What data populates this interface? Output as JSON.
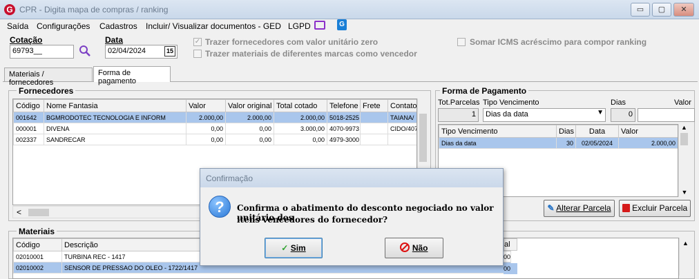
{
  "window": {
    "title": "CPR - Digita mapa de compras / ranking",
    "min": "▭",
    "max": "▢",
    "close": "✕"
  },
  "menu": {
    "items": [
      "Saída",
      "Configurações",
      "Cadastros",
      "Incluir/ Visualizar documentos - GED",
      "LGPD"
    ]
  },
  "header": {
    "cotacao_label": "Cotação",
    "cotacao_value": "69793__",
    "data_label": "Data",
    "data_value": "02/04/2024",
    "calendar": "15",
    "opt1": "Trazer fornecedores com valor unitário zero",
    "opt1_checked": "✓",
    "opt2": "Trazer materiais de diferentes marcas como vencedor",
    "opt3": "Somar ICMS acréscimo para compor ranking"
  },
  "tabs": [
    "Materiais / fornecedores",
    "Forma de pagamento"
  ],
  "fornecedores": {
    "title": "Fornecedores",
    "columns": [
      "Código",
      "Nome Fantasia",
      "Valor",
      "Valor original",
      "Total cotado",
      "Telefone",
      "Frete",
      "Contato"
    ],
    "rows": [
      [
        "001642",
        "BGMRODOTEC TECNOLOGIA E INFORM",
        "2.000,00",
        "2.000,00",
        "2.000,00",
        "5018-2525",
        "",
        "TAIANA/"
      ],
      [
        "000001",
        "DIVENA",
        "0,00",
        "0,00",
        "3.000,00",
        "4070-9973",
        "",
        "CIDO/407"
      ],
      [
        "002337",
        "SANDRECAR",
        "0,00",
        "0,00",
        "0,00",
        "4979-3000",
        "",
        ""
      ]
    ],
    "scroll_left": "<"
  },
  "pagamento": {
    "title": "Forma de Pagamento",
    "tot_parcelas_label": "Tot.Parcelas",
    "tot_parcelas": "1",
    "tipo_label": "Tipo Vencimento",
    "tipo_value": "Dias da data",
    "dias_label": "Dias",
    "dias_value": "0",
    "valor_label": "Valor",
    "columns": [
      "Tipo Vencimento",
      "Dias",
      "Data",
      "Valor"
    ],
    "rows": [
      [
        "Dias da data",
        "30",
        "02/05/2024",
        "2.000,00"
      ]
    ],
    "alterar": "Alterar Parcela",
    "excluir": "Excluir Parcela"
  },
  "materiais": {
    "title": "Materiais",
    "columns": [
      "Código",
      "Descrição"
    ],
    "rows": [
      [
        "02010001",
        "TURBINA REC - 1417"
      ],
      [
        "02010002",
        "SENSOR DE PRESSAO DO OLEO - 1722/1417"
      ]
    ],
    "partial_header": "al",
    "partial_values": [
      "00",
      "00"
    ]
  },
  "dialog": {
    "title": "Confirmação",
    "message_line1": "Confirma o abatimento do desconto negociado no valor unitário dos",
    "message_line2": "itens vencedores do fornecedor?",
    "icon": "?",
    "yes": "Sim",
    "no": "Não"
  },
  "colors": {
    "selected_row": "#a9c6ec",
    "dialog_icon": "#3d8ee6"
  }
}
